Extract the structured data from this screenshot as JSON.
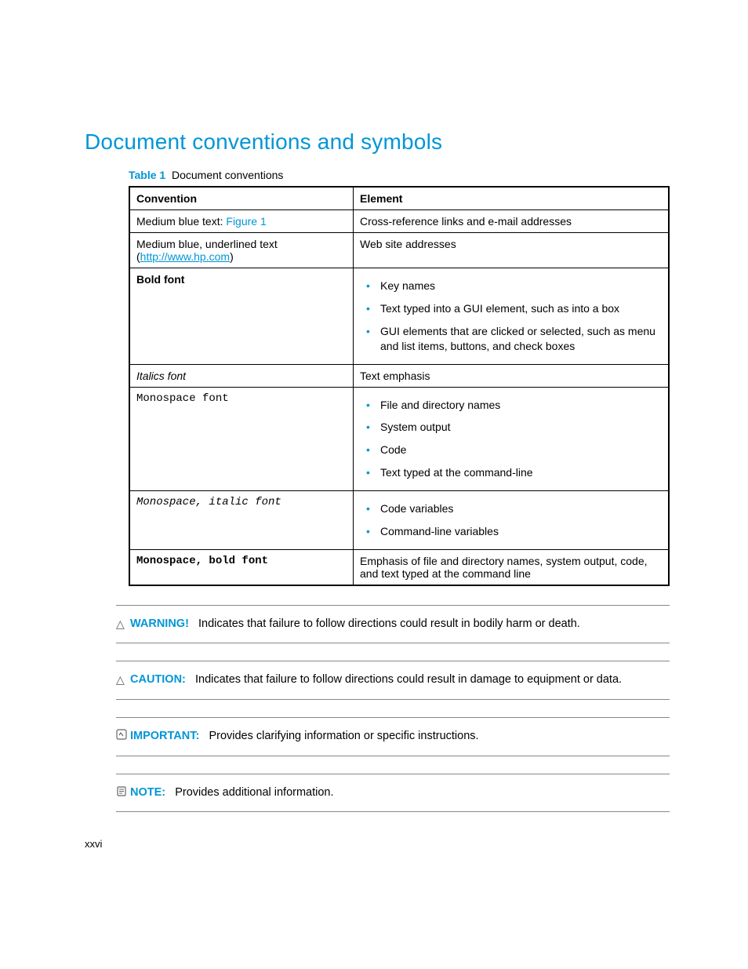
{
  "heading": "Document conventions and symbols",
  "table": {
    "label": "Table 1",
    "caption": "Document conventions",
    "headers": {
      "c1": "Convention",
      "c2": "Element"
    },
    "rows": {
      "r1": {
        "c1_prefix": "Medium blue text: ",
        "c1_link": "Figure 1",
        "c2": "Cross-reference links and e-mail addresses"
      },
      "r2": {
        "c1_prefix": "Medium blue, underlined text (",
        "c1_link": "http://www.hp.com",
        "c1_suffix": ")",
        "c2": "Web site addresses"
      },
      "r3": {
        "c1": "Bold font",
        "items": {
          "i1": "Key names",
          "i2": "Text typed into a GUI element, such as into a box",
          "i3": "GUI elements that are clicked or selected, such as menu and list items, buttons, and check boxes"
        }
      },
      "r4": {
        "c1": "Italics font",
        "c2": "Text emphasis"
      },
      "r5": {
        "c1": "Monospace font",
        "items": {
          "i1": "File and directory names",
          "i2": "System output",
          "i3": "Code",
          "i4": "Text typed at the command-line"
        }
      },
      "r6": {
        "c1": "Monospace, italic font",
        "items": {
          "i1": "Code variables",
          "i2": "Command-line variables"
        }
      },
      "r7": {
        "c1": "Monospace, bold font",
        "c2": "Emphasis of file and directory names, system output, code, and text typed at the command line"
      }
    }
  },
  "callouts": {
    "warning": {
      "label": "WARNING!",
      "text": "Indicates that failure to follow directions could result in bodily harm or death."
    },
    "caution": {
      "label": "CAUTION:",
      "text": "Indicates that failure to follow directions could result in damage to equipment or data."
    },
    "important": {
      "label": "IMPORTANT:",
      "text": "Provides clarifying information or specific instructions."
    },
    "note": {
      "label": "NOTE:",
      "text": "Provides additional information."
    }
  },
  "page_number": "xxvi"
}
